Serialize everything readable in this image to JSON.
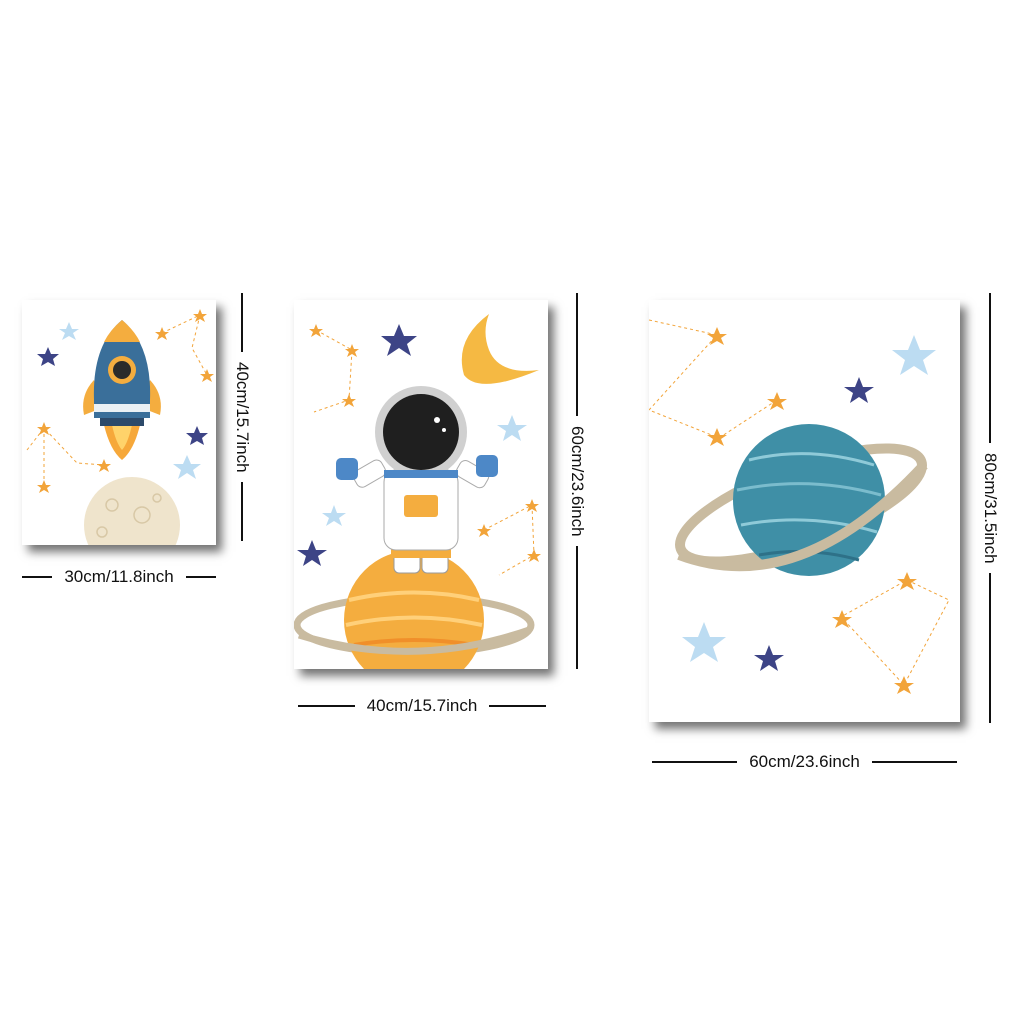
{
  "posters": [
    {
      "subject": "rocket",
      "width_label": "30cm/11.8inch",
      "height_label": "40cm/15.7inch"
    },
    {
      "subject": "astronaut",
      "width_label": "40cm/15.7inch",
      "height_label": "60cm/23.6inch"
    },
    {
      "subject": "planet",
      "width_label": "60cm/23.6inch",
      "height_label": "80cm/31.5inch"
    }
  ],
  "colors": {
    "navy_star": "#3d4486",
    "orange_star": "#f2a43a",
    "light_blue_star": "#bcdcf2",
    "planet_teal": "#3f8fa6",
    "orange_planet": "#f4ad3f",
    "ring": "#c9bba0",
    "moon_yellow": "#f5b943"
  }
}
